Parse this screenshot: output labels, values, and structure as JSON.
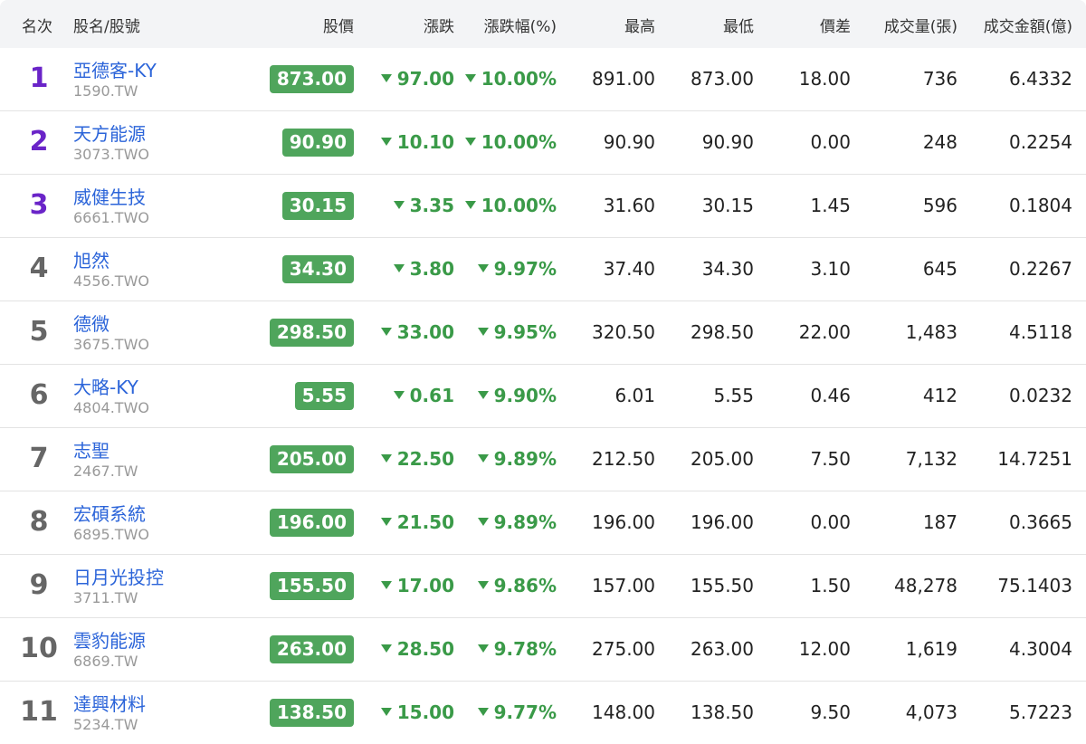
{
  "colors": {
    "up_down_green": "#3a9a48",
    "price_bg": "#4fa55c",
    "rank_top": "#6a24c8",
    "link": "#2b64d9"
  },
  "headers": {
    "rank": "名次",
    "name": "股名/股號",
    "price": "股價",
    "change": "漲跌",
    "change_pct": "漲跌幅(%)",
    "high": "最高",
    "low": "最低",
    "spread": "價差",
    "volume": "成交量(張)",
    "amount": "成交金額(億)"
  },
  "rows": [
    {
      "rank": "1",
      "name": "亞德客-KY",
      "code": "1590.TW",
      "price": "873.00",
      "change": "97.00",
      "change_pct": "10.00%",
      "high": "891.00",
      "low": "873.00",
      "spread": "18.00",
      "volume": "736",
      "amount": "6.4332",
      "direction": "down"
    },
    {
      "rank": "2",
      "name": "天方能源",
      "code": "3073.TWO",
      "price": "90.90",
      "change": "10.10",
      "change_pct": "10.00%",
      "high": "90.90",
      "low": "90.90",
      "spread": "0.00",
      "volume": "248",
      "amount": "0.2254",
      "direction": "down"
    },
    {
      "rank": "3",
      "name": "威健生技",
      "code": "6661.TWO",
      "price": "30.15",
      "change": "3.35",
      "change_pct": "10.00%",
      "high": "31.60",
      "low": "30.15",
      "spread": "1.45",
      "volume": "596",
      "amount": "0.1804",
      "direction": "down"
    },
    {
      "rank": "4",
      "name": "旭然",
      "code": "4556.TWO",
      "price": "34.30",
      "change": "3.80",
      "change_pct": "9.97%",
      "high": "37.40",
      "low": "34.30",
      "spread": "3.10",
      "volume": "645",
      "amount": "0.2267",
      "direction": "down"
    },
    {
      "rank": "5",
      "name": "德微",
      "code": "3675.TWO",
      "price": "298.50",
      "change": "33.00",
      "change_pct": "9.95%",
      "high": "320.50",
      "low": "298.50",
      "spread": "22.00",
      "volume": "1,483",
      "amount": "4.5118",
      "direction": "down"
    },
    {
      "rank": "6",
      "name": "大略-KY",
      "code": "4804.TWO",
      "price": "5.55",
      "change": "0.61",
      "change_pct": "9.90%",
      "high": "6.01",
      "low": "5.55",
      "spread": "0.46",
      "volume": "412",
      "amount": "0.0232",
      "direction": "down"
    },
    {
      "rank": "7",
      "name": "志聖",
      "code": "2467.TW",
      "price": "205.00",
      "change": "22.50",
      "change_pct": "9.89%",
      "high": "212.50",
      "low": "205.00",
      "spread": "7.50",
      "volume": "7,132",
      "amount": "14.7251",
      "direction": "down"
    },
    {
      "rank": "8",
      "name": "宏碩系統",
      "code": "6895.TWO",
      "price": "196.00",
      "change": "21.50",
      "change_pct": "9.89%",
      "high": "196.00",
      "low": "196.00",
      "spread": "0.00",
      "volume": "187",
      "amount": "0.3665",
      "direction": "down"
    },
    {
      "rank": "9",
      "name": "日月光投控",
      "code": "3711.TW",
      "price": "155.50",
      "change": "17.00",
      "change_pct": "9.86%",
      "high": "157.00",
      "low": "155.50",
      "spread": "1.50",
      "volume": "48,278",
      "amount": "75.1403",
      "direction": "down"
    },
    {
      "rank": "10",
      "name": "雲豹能源",
      "code": "6869.TW",
      "price": "263.00",
      "change": "28.50",
      "change_pct": "9.78%",
      "high": "275.00",
      "low": "263.00",
      "spread": "12.00",
      "volume": "1,619",
      "amount": "4.3004",
      "direction": "down"
    },
    {
      "rank": "11",
      "name": "達興材料",
      "code": "5234.TW",
      "price": "138.50",
      "change": "15.00",
      "change_pct": "9.77%",
      "high": "148.00",
      "low": "138.50",
      "spread": "9.50",
      "volume": "4,073",
      "amount": "5.7223",
      "direction": "down"
    }
  ]
}
